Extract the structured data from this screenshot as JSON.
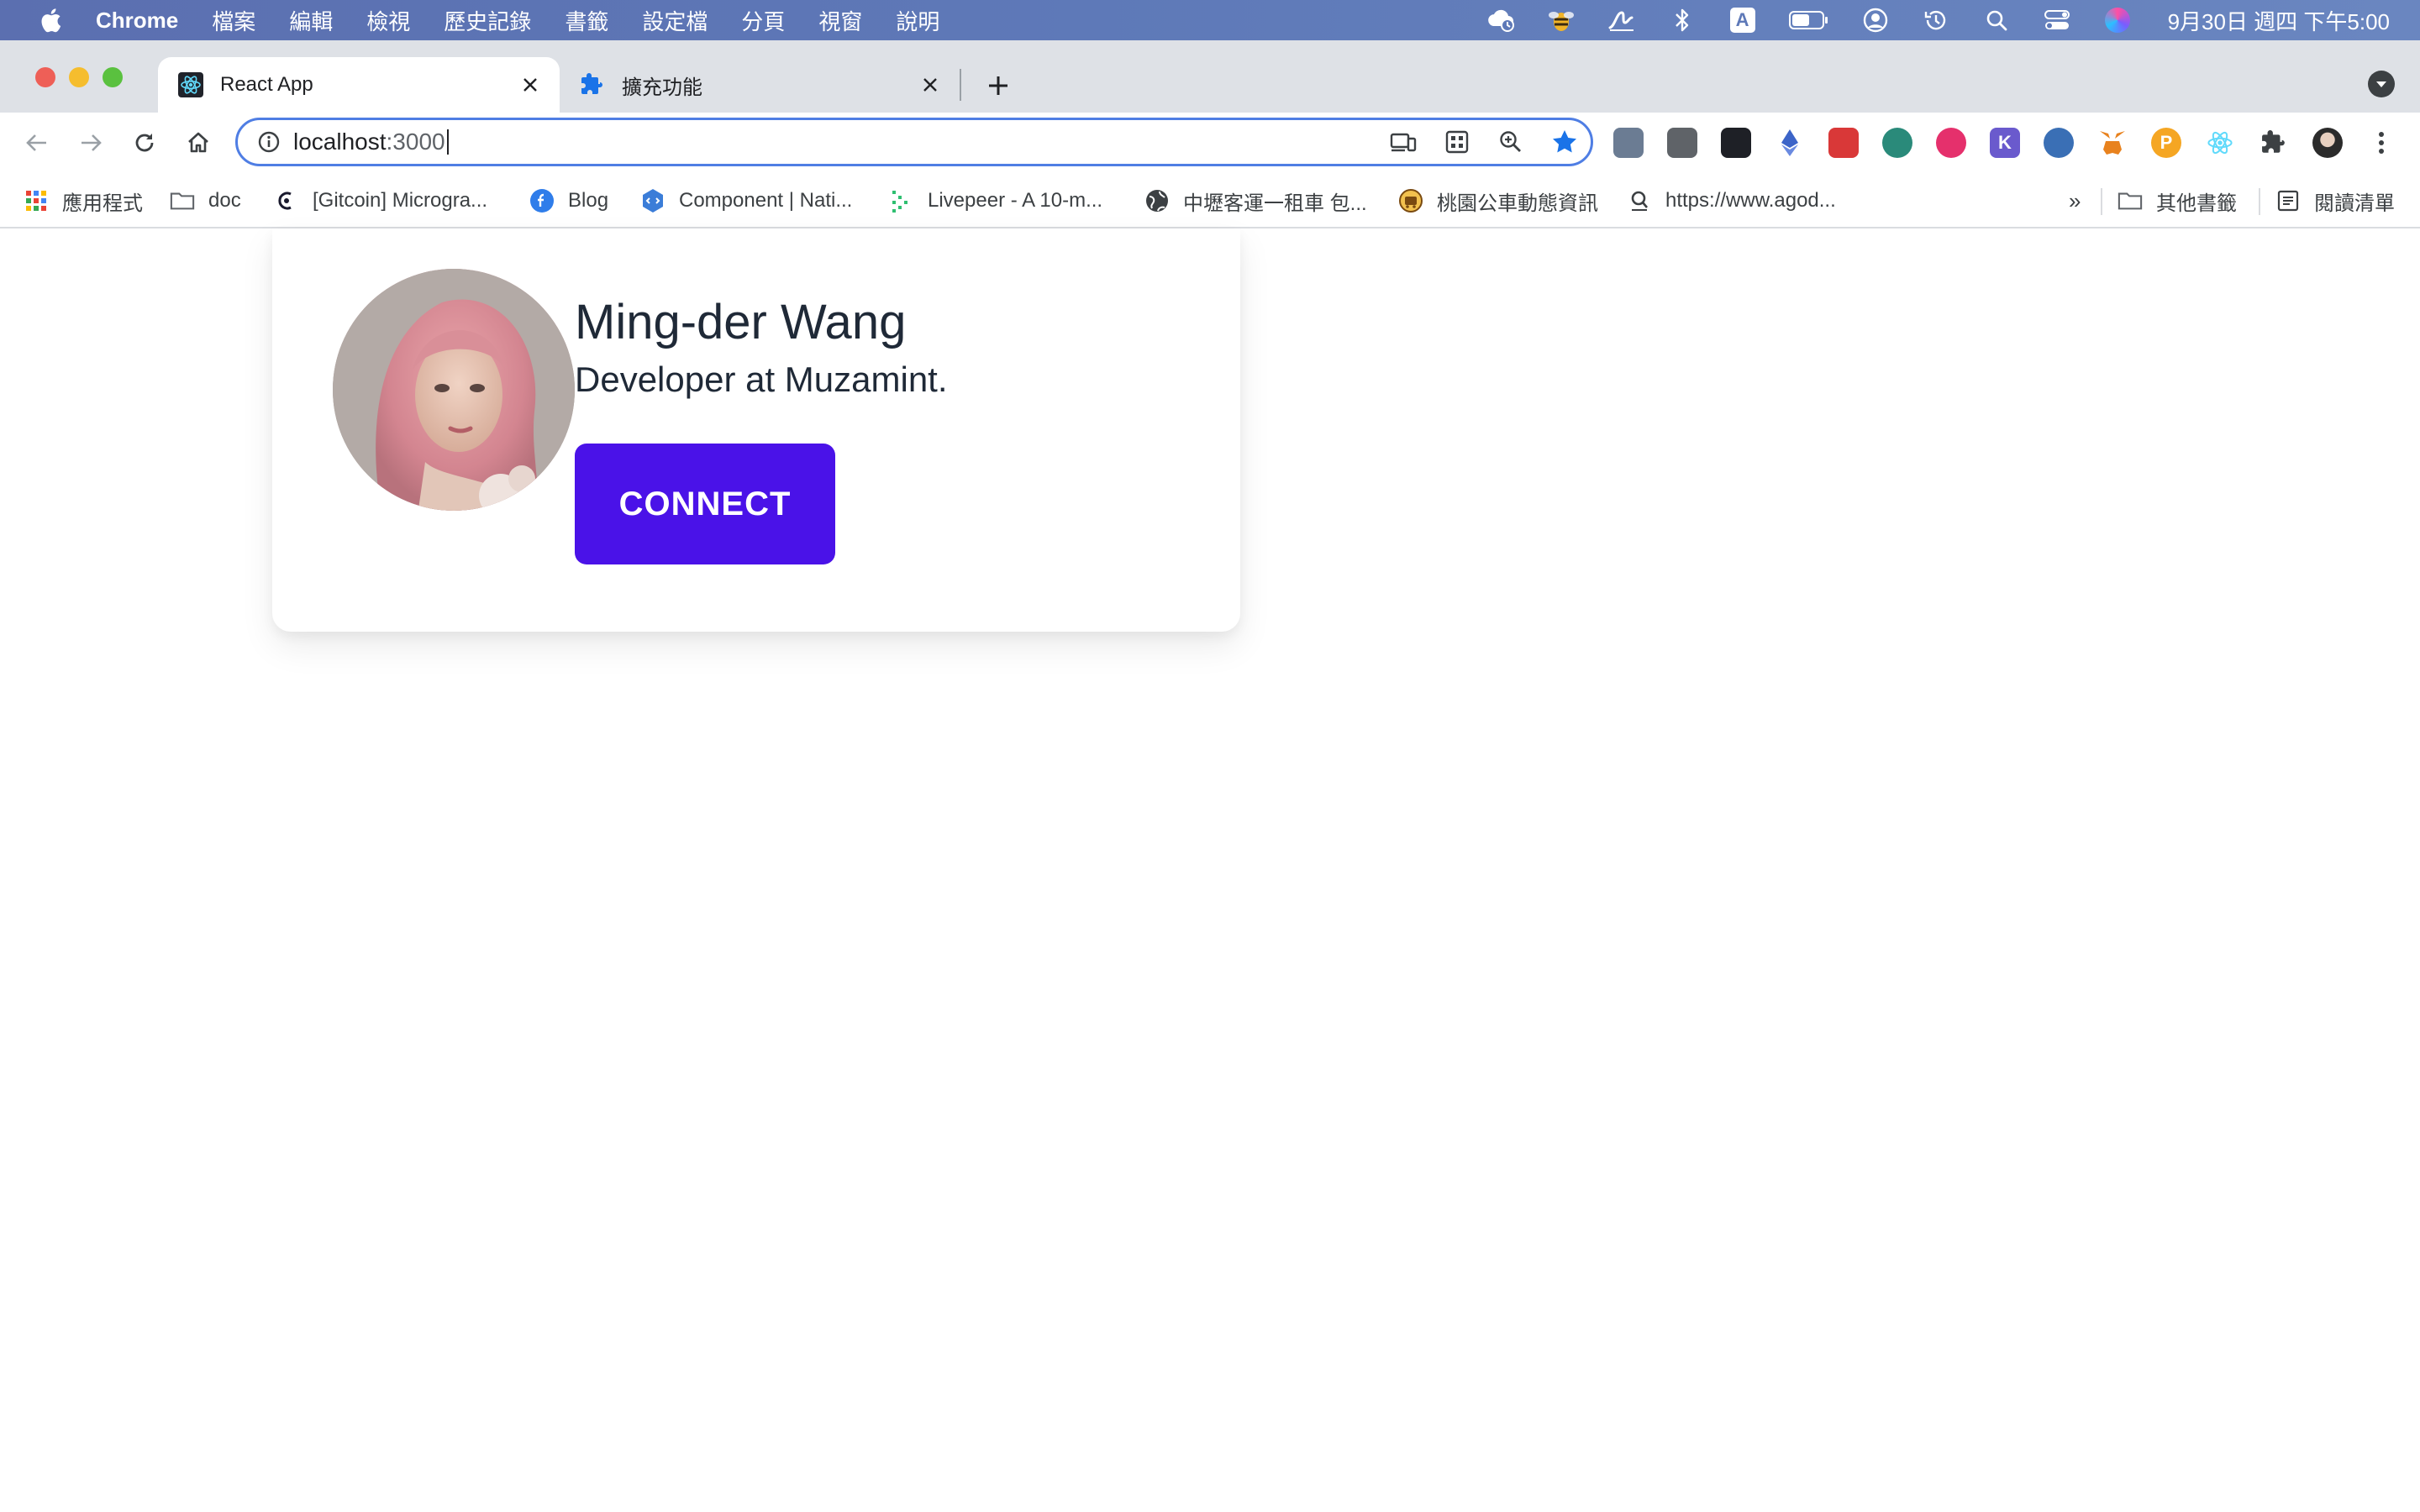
{
  "menubar": {
    "app_name": "Chrome",
    "items": [
      "檔案",
      "編輯",
      "檢視",
      "歷史記錄",
      "書籤",
      "設定檔",
      "分頁",
      "視窗",
      "說明"
    ],
    "clock": "9月30日 週四 下午5:00",
    "status_icons": [
      "cloud-sync-icon",
      "bee-icon",
      "signature-icon",
      "bluetooth-icon",
      "input-method-icon",
      "battery-icon",
      "user-account-icon",
      "time-machine-icon",
      "spotlight-icon",
      "control-center-icon",
      "siri-icon"
    ],
    "input_method_label": "A"
  },
  "tabs": [
    {
      "title": "React App",
      "active": true,
      "icon": "react-icon"
    },
    {
      "title": "擴充功能",
      "active": false,
      "icon": "puzzle-icon"
    }
  ],
  "omnibox": {
    "host": "localhost",
    "port": ":3000"
  },
  "extensions": [
    {
      "name": "ext-image-icon",
      "color": "#6b7c93",
      "label": ""
    },
    {
      "name": "ext-cube-icon",
      "color": "#5f6368",
      "label": ""
    },
    {
      "name": "ext-binance-icon",
      "color": "#1e2026",
      "label": ""
    },
    {
      "name": "ext-ethereum-icon",
      "color": "#3c64c8",
      "label": ""
    },
    {
      "name": "ext-cat-icon",
      "color": "#d93838",
      "label": ""
    },
    {
      "name": "ext-green-circle-icon",
      "color": "#2a8a7a",
      "label": ""
    },
    {
      "name": "ext-m-icon",
      "color": "#e5306c",
      "label": ""
    },
    {
      "name": "ext-k-icon",
      "color": "#6a5acd",
      "label": "K"
    },
    {
      "name": "ext-compass-icon",
      "color": "#3a6fb5",
      "label": ""
    },
    {
      "name": "ext-metamask-icon",
      "color": "#e8821e",
      "label": ""
    },
    {
      "name": "ext-p-icon",
      "color": "#f5a623",
      "label": "P"
    },
    {
      "name": "ext-react-devtools-icon",
      "color": "#61dafb",
      "label": ""
    },
    {
      "name": "extensions-puzzle-icon",
      "color": "#5f6368",
      "label": ""
    },
    {
      "name": "profile-avatar-icon",
      "color": "#444",
      "label": ""
    },
    {
      "name": "chrome-menu-icon",
      "color": "#5f6368",
      "label": ""
    }
  ],
  "bookmarks": [
    {
      "label": "應用程式",
      "icon": "apps-grid-icon"
    },
    {
      "label": "doc",
      "icon": "folder-icon"
    },
    {
      "label": "[Gitcoin] Microgra...",
      "icon": "gitcoin-icon"
    },
    {
      "label": "Blog",
      "icon": "blog-icon"
    },
    {
      "label": "Component | Nati...",
      "icon": "hexagon-icon"
    },
    {
      "label": "Livepeer - A 10-m...",
      "icon": "livepeer-icon"
    },
    {
      "label": "中壢客運一租車 包...",
      "icon": "globe-icon"
    },
    {
      "label": "桃園公車動態資訊",
      "icon": "bus-icon"
    },
    {
      "label": "https://www.agod...",
      "icon": "agoda-icon"
    }
  ],
  "bookmarks_overflow": "»",
  "bookmarks_right": [
    {
      "label": "其他書籤",
      "icon": "folder-icon"
    },
    {
      "label": "閱讀清單",
      "icon": "reading-list-icon"
    }
  ],
  "profile": {
    "name": "Ming-der Wang",
    "title": "Developer at Muzamint.",
    "button_label": "CONNECT"
  },
  "colors": {
    "accent": "#4a12e8",
    "omnibox_focus": "#4f7ee4",
    "text": "#1f2937"
  }
}
